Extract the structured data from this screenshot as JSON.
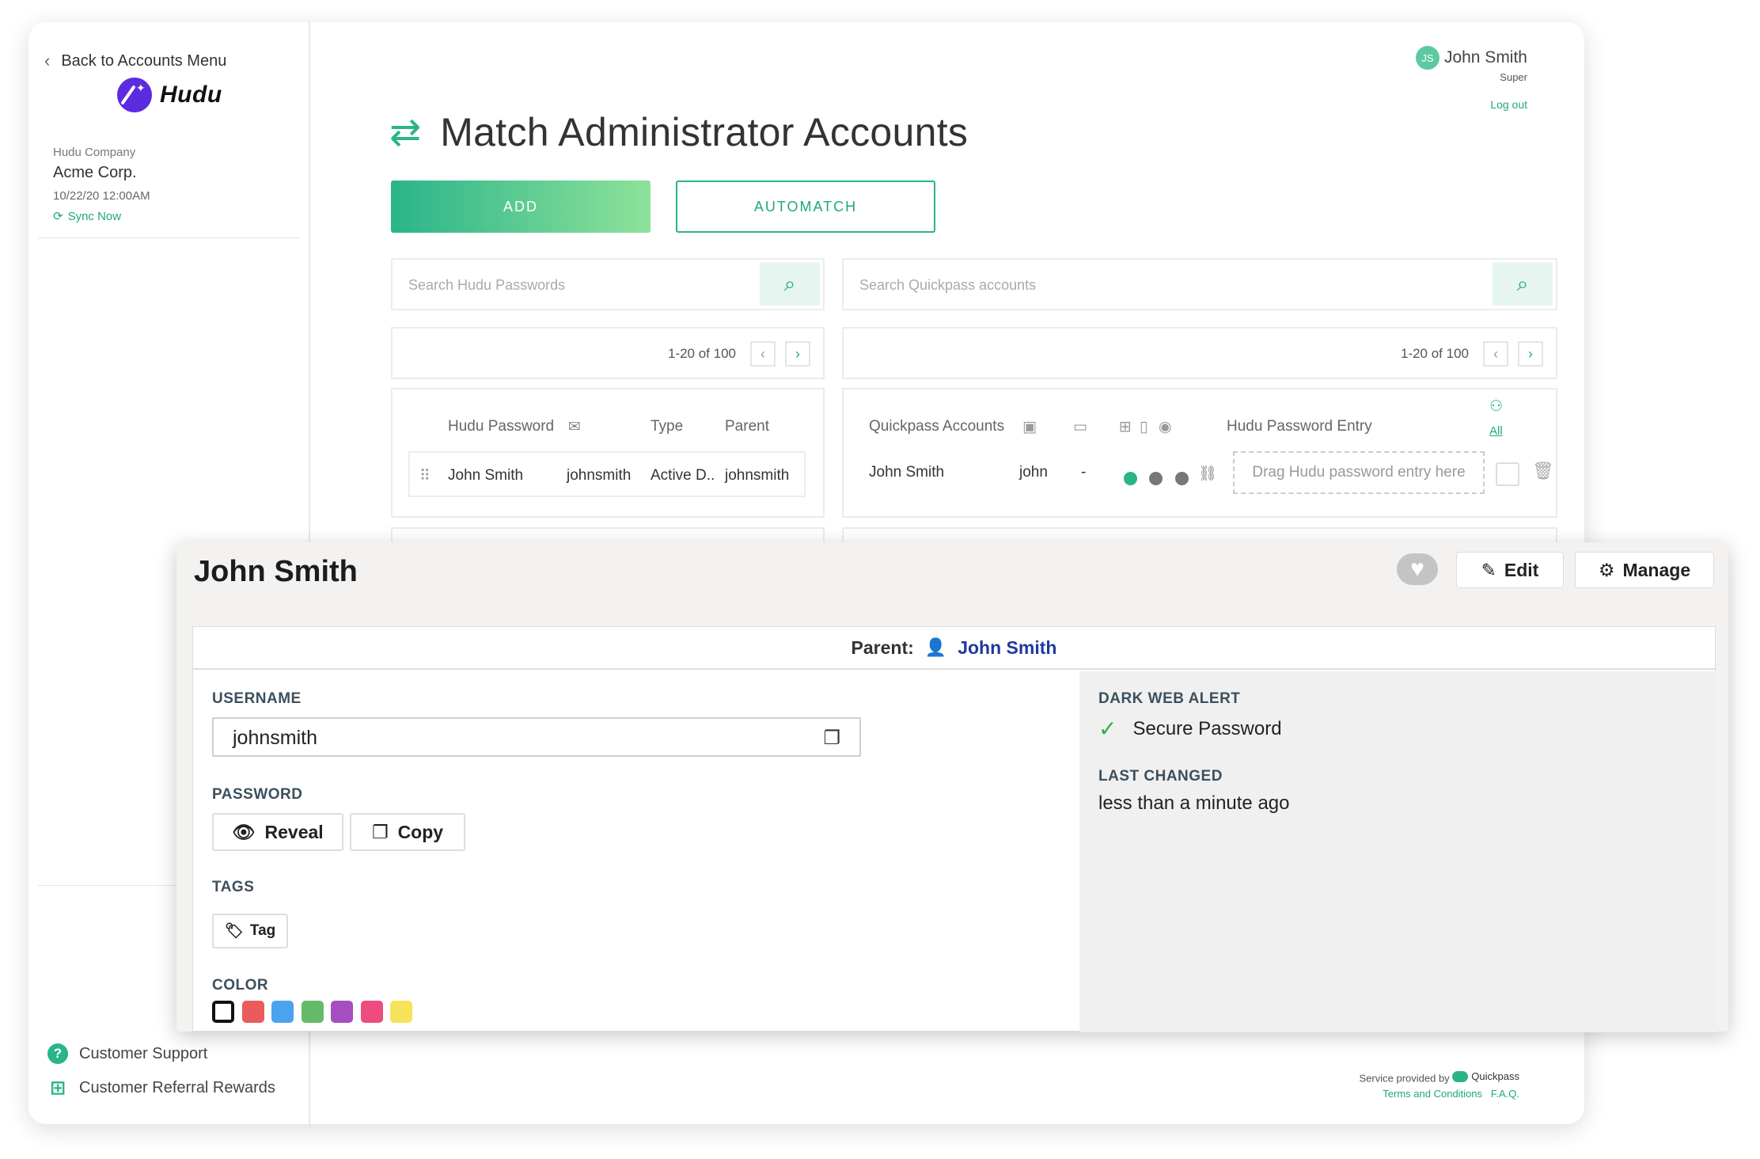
{
  "sidebar": {
    "back_label": "Back to Accounts Menu",
    "logo_text": "Hudu",
    "company_label": "Hudu Company",
    "company_name": "Acme Corp.",
    "date": "10/22/20 12:00AM",
    "sync_label": "Sync Now",
    "support_label": "Customer Support",
    "referral_label": "Customer Referral Rewards"
  },
  "user": {
    "initials": "JS",
    "name": "John Smith",
    "role": "Super",
    "logout": "Log out"
  },
  "page": {
    "title": "Match Administrator Accounts"
  },
  "buttons": {
    "add": "ADD",
    "automatch": "AUTOMATCH"
  },
  "search": {
    "hudu_placeholder": "Search Hudu Passwords",
    "quickpass_placeholder": "Search Quickpass accounts"
  },
  "pager": {
    "left": "1-20 of 100",
    "right": "1-20 of 100"
  },
  "hudu_table": {
    "headers": [
      "Hudu Password",
      "Type",
      "Parent"
    ],
    "row": {
      "name": "John Smith",
      "username": "johnsmith",
      "type": "Active D..",
      "parent": "johnsmith"
    }
  },
  "quickpass_table": {
    "headers": {
      "accounts": "Quickpass Accounts",
      "entry": "Hudu Password Entry",
      "all": "All"
    },
    "row": {
      "name": "John Smith",
      "user": "john",
      "dash": "-",
      "drop": "Drag Hudu password entry here"
    },
    "dot_colors": [
      "#2bb48a",
      "#777777",
      "#777777"
    ]
  },
  "footer": {
    "service": "Service provided by",
    "brand": "Quickpass",
    "terms": "Terms and Conditions",
    "faq": "F.A.Q."
  },
  "panel": {
    "title": "John Smith",
    "edit": "Edit",
    "manage": "Manage",
    "parent_label": "Parent:",
    "parent_value": "John Smith",
    "username_label": "USERNAME",
    "username_value": "johnsmith",
    "password_label": "PASSWORD",
    "reveal": "Reveal",
    "copy": "Copy",
    "tags_label": "TAGS",
    "tag": "Tag",
    "color_label": "COLOR",
    "colors": [
      "#111111",
      "#ec5b5b",
      "#4aa3ee",
      "#63bb68",
      "#a44ec0",
      "#ee4b7e",
      "#f7e35a"
    ],
    "dark_web_label": "DARK WEB ALERT",
    "dark_web_value": "Secure Password",
    "last_changed_label": "LAST CHANGED",
    "last_changed_value": "less than a minute ago"
  }
}
